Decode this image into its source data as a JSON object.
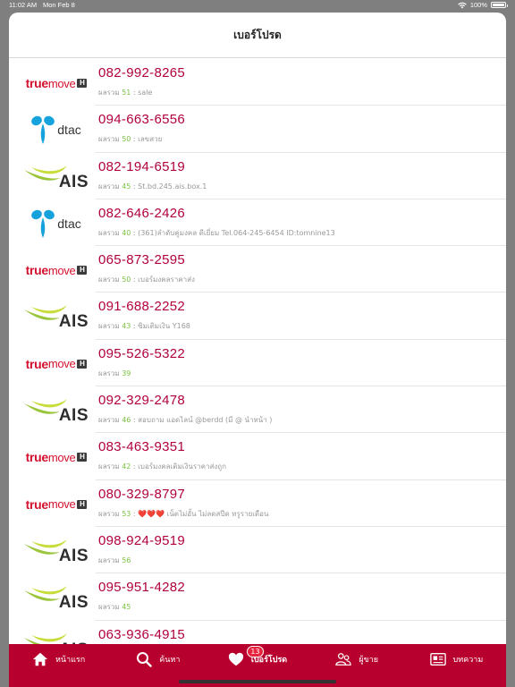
{
  "status": {
    "time": "11:02 AM",
    "date": "Mon Feb 8",
    "battery": "100%"
  },
  "header": {
    "title": "เบอร์โปรด"
  },
  "score_prefix": "ผลรวม",
  "rows": [
    {
      "carrier": "truemove",
      "number": "082-992-8265",
      "score": "51",
      "note": " : sale"
    },
    {
      "carrier": "dtac",
      "number": "094-663-6556",
      "score": "50",
      "note": " : เลขสวย"
    },
    {
      "carrier": "ais",
      "number": "082-194-6519",
      "score": "45",
      "note": " : St.bd.245.ais.box.1"
    },
    {
      "carrier": "dtac",
      "number": "082-646-2426",
      "score": "40",
      "note": " : (361)ลำดับคู่มงคล ดีเยี่ยม Tel.064-245-6454 ID:tomnine13"
    },
    {
      "carrier": "truemove",
      "number": "065-873-2595",
      "score": "50",
      "note": " : เบอร์มงคลราคาส่ง"
    },
    {
      "carrier": "ais",
      "number": "091-688-2252",
      "score": "43",
      "note": " : ซิมเติมเงิน Y168"
    },
    {
      "carrier": "truemove",
      "number": "095-526-5322",
      "score": "39",
      "note": ""
    },
    {
      "carrier": "ais",
      "number": "092-329-2478",
      "score": "46",
      "note": " : สอบถาม แอดไลน์ @berdd (มี @ นำหน้า )"
    },
    {
      "carrier": "truemove",
      "number": "083-463-9351",
      "score": "42",
      "note": " : เบอร์มงคลเติมเงินราคาส่งถูก"
    },
    {
      "carrier": "truemove",
      "number": "080-329-8797",
      "score": "53",
      "note": " : ❤️❤️❤️ เน็ตไม่อั้น  ไม่ลดสปีด  ทรูรายเดือน"
    },
    {
      "carrier": "ais",
      "number": "098-924-9519",
      "score": "56",
      "note": ""
    },
    {
      "carrier": "ais",
      "number": "095-951-4282",
      "score": "45",
      "note": ""
    },
    {
      "carrier": "ais",
      "number": "063-936-4915",
      "score": "",
      "note": ""
    }
  ],
  "logos": {
    "truemove": {
      "t1": "true",
      "t2": "move",
      "h": "H"
    },
    "dtac": {
      "word": "dtac"
    },
    "ais": {
      "word": "AIS"
    }
  },
  "tabs": [
    {
      "label": "หน้าแรก",
      "icon": "home-icon"
    },
    {
      "label": "ค้นหา",
      "icon": "search-icon"
    },
    {
      "label": "เบอร์โปรด",
      "icon": "heart-icon",
      "badge": "13",
      "active": true
    },
    {
      "label": "ผู้ขาย",
      "icon": "sellers-icon"
    },
    {
      "label": "บทความ",
      "icon": "article-icon"
    }
  ],
  "colors": {
    "accent": "#b8002e",
    "number": "#b1003f",
    "score": "#7cc242"
  }
}
